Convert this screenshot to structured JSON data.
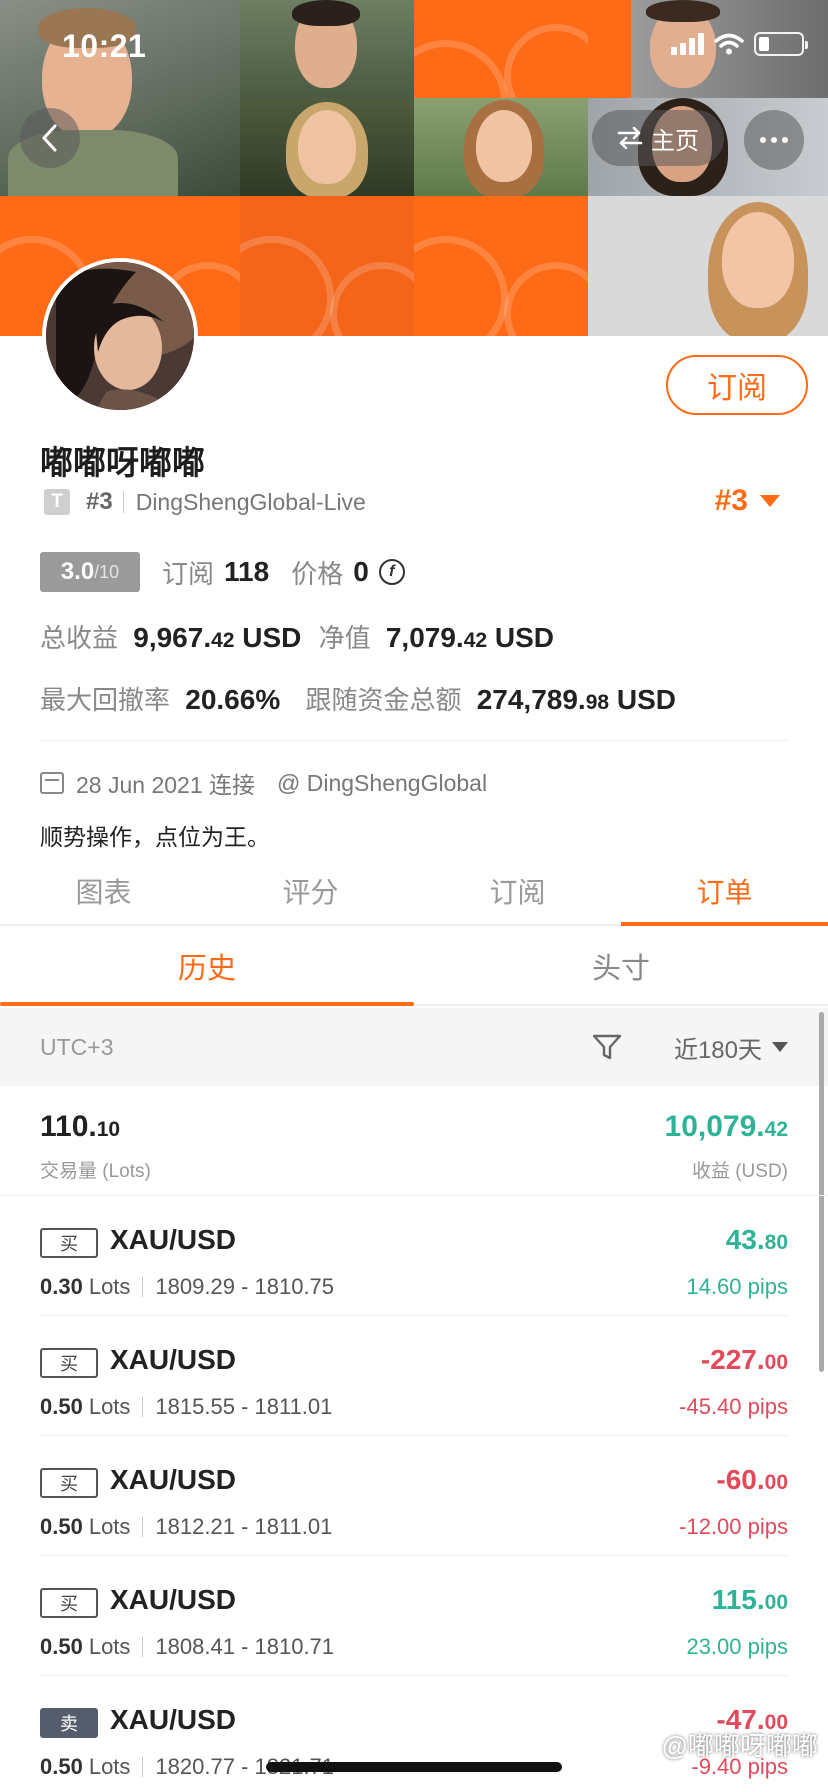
{
  "status_bar": {
    "time": "10:21"
  },
  "nav": {
    "home_label": "主页"
  },
  "profile": {
    "name": "嘟嘟呀嘟嘟",
    "rank": "#3",
    "server": "DingShengGlobal-Live",
    "rank_badge": "#3",
    "subscribe_label": "订阅",
    "score": "3.0",
    "score_denominator": "/10",
    "subscribe_count_label": "订阅",
    "subscribe_count": "118",
    "price_label": "价格",
    "price": "0",
    "total_profit_label": "总收益",
    "total_profit_int": "9,967.",
    "total_profit_dec": "42",
    "total_profit_unit": "USD",
    "equity_label": "净值",
    "equity_int": "7,079.",
    "equity_dec": "42",
    "equity_unit": "USD",
    "max_drawdown_label": "最大回撤率",
    "max_drawdown": "20.66%",
    "follow_funds_label": "跟随资金总额",
    "follow_funds_int": "274,789.",
    "follow_funds_dec": "98",
    "follow_funds_unit": "USD",
    "connected_date": "28 Jun 2021 连接",
    "handle": "@ DingShengGlobal",
    "bio": "顺势操作，点位为王。"
  },
  "main_tabs": [
    {
      "label": "图表"
    },
    {
      "label": "评分"
    },
    {
      "label": "订阅"
    },
    {
      "label": "订单"
    }
  ],
  "sub_tabs": [
    {
      "label": "历史"
    },
    {
      "label": "头寸"
    }
  ],
  "filter": {
    "timezone": "UTC+3",
    "range": "近180天"
  },
  "summary": {
    "lots_int": "110.",
    "lots_dec": "10",
    "lots_label": "交易量 (Lots)",
    "pnl_int": "10,079.",
    "pnl_dec": "42",
    "pnl_label": "收益 (USD)"
  },
  "orders": [
    {
      "side": "买",
      "symbol": "XAU/USD",
      "lots": "0.30",
      "lots_unit": "Lots",
      "range": "1809.29 - 1810.75",
      "amount_int": "43.",
      "amount_dec": "80",
      "pips": "14.60 pips"
    },
    {
      "side": "买",
      "symbol": "XAU/USD",
      "lots": "0.50",
      "lots_unit": "Lots",
      "range": "1815.55 - 1811.01",
      "amount_int": "-227.",
      "amount_dec": "00",
      "pips": "-45.40 pips"
    },
    {
      "side": "买",
      "symbol": "XAU/USD",
      "lots": "0.50",
      "lots_unit": "Lots",
      "range": "1812.21 - 1811.01",
      "amount_int": "-60.",
      "amount_dec": "00",
      "pips": "-12.00 pips"
    },
    {
      "side": "买",
      "symbol": "XAU/USD",
      "lots": "0.50",
      "lots_unit": "Lots",
      "range": "1808.41 - 1810.71",
      "amount_int": "115.",
      "amount_dec": "00",
      "pips": "23.00 pips"
    },
    {
      "side": "卖",
      "symbol": "XAU/USD",
      "lots": "0.50",
      "lots_unit": "Lots",
      "range": "1820.77 - 1821.71",
      "amount_int": "-47.",
      "amount_dec": "00",
      "pips": "-9.40 pips"
    }
  ],
  "watermark": "@嘟嘟呀嘟嘟",
  "colors": {
    "accent": "#ff6a16",
    "profit": "#2fb397",
    "loss": "#e2495a"
  }
}
